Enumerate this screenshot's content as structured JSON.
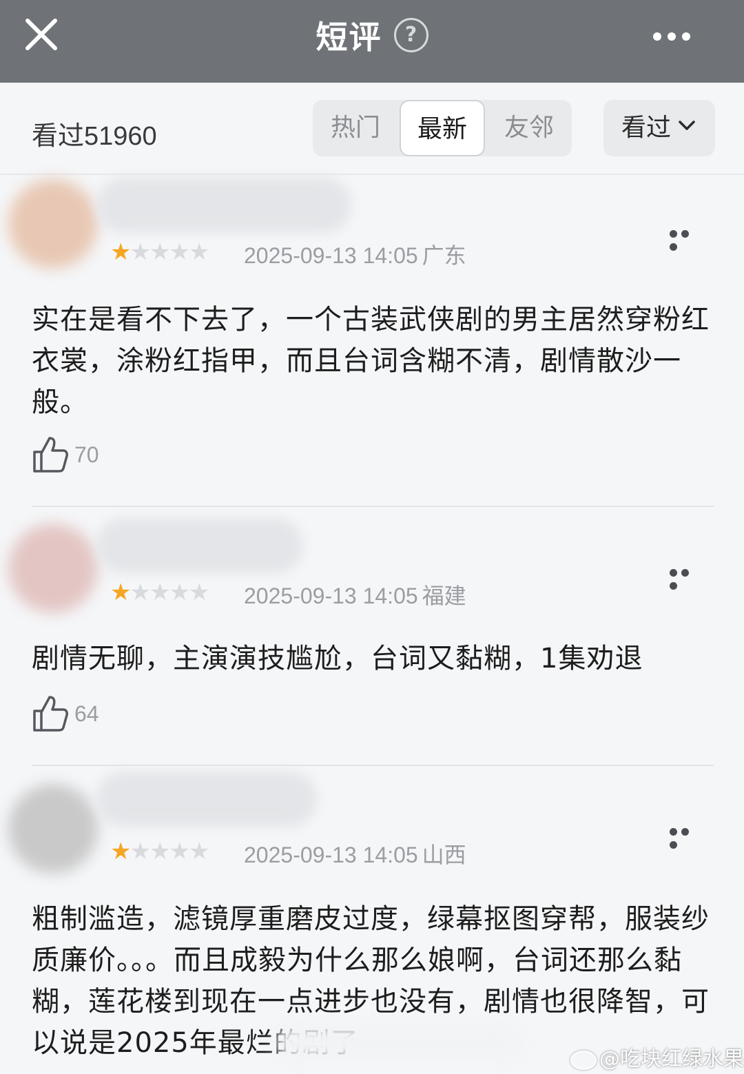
{
  "header": {
    "title": "短评",
    "help_symbol": "?",
    "close_icon": "close-icon",
    "more_icon": "more-horizontal-icon",
    "bar_color": "#6f7377"
  },
  "filter": {
    "seen_label": "看过",
    "seen_count": "51960",
    "tabs": [
      {
        "label": "热门",
        "active": false
      },
      {
        "label": "最新",
        "active": true
      },
      {
        "label": "友邻",
        "active": false
      }
    ],
    "dropdown_label": "看过",
    "dropdown_icon": "chevron-down-icon"
  },
  "comments": [
    {
      "rating": 1,
      "rating_max": 5,
      "datetime": "2025-09-13 14:05",
      "location": "广东",
      "text": "实在是看不下去了，一个古装武侠剧的男主居然穿粉红衣裳，涂粉红指甲，而且台词含糊不清，剧情散沙一般。",
      "likes": "70",
      "avatar_color": "#e8c8b4"
    },
    {
      "rating": 1,
      "rating_max": 5,
      "datetime": "2025-09-13 14:05",
      "location": "福建",
      "text": "剧情无聊，主演演技尴尬，台词又黏糊，1集劝退",
      "likes": "64",
      "avatar_color": "#e3c6c4"
    },
    {
      "rating": 1,
      "rating_max": 5,
      "datetime": "2025-09-13 14:05",
      "location": "山西",
      "text": "粗制滥造，滤镜厚重磨皮过度，绿幕抠图穿帮，服装纱质廉价。。。而且成毅为什么那么娘啊，台词还那么黏糊，莲花楼到现在一点进步也没有，剧情也很降智，可以说是2025年最烂的剧了",
      "likes": "",
      "avatar_color": "#c9c9c9"
    }
  ],
  "accent_star_color": "#f5a623",
  "watermark": "@吃块红绿水果"
}
